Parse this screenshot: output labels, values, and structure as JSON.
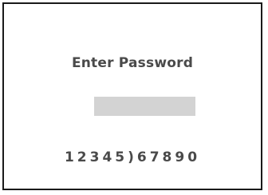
{
  "screen": {
    "title": "Enter Password",
    "password_value": "",
    "digits_row": "12345)67890"
  },
  "colors": {
    "border": "#1a1a1a",
    "text": "#4a4a4a",
    "field": "#d3d3d3",
    "background": "#ffffff"
  }
}
